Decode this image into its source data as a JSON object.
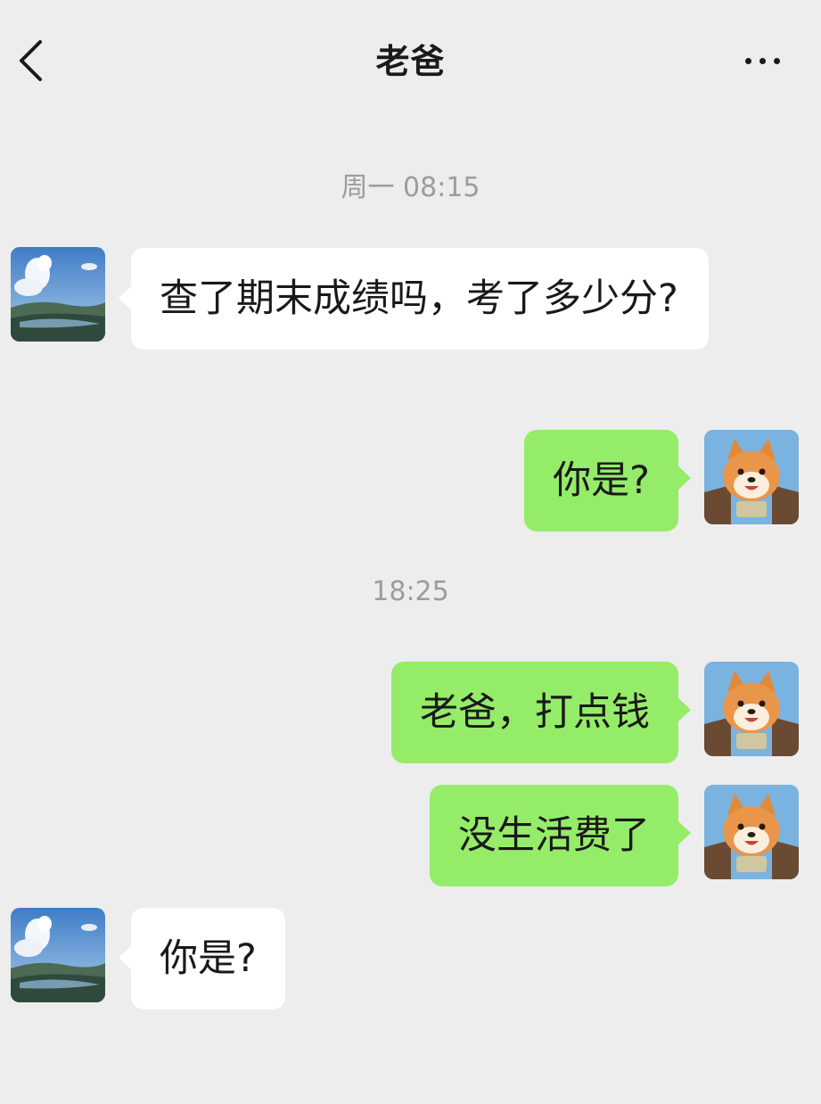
{
  "header": {
    "title": "老爸",
    "back_icon": "chevron-left-icon",
    "more_icon": "more-dots-icon"
  },
  "messages": [
    {
      "type": "timestamp",
      "text": "周一 08:15"
    },
    {
      "type": "incoming",
      "text": "查了期末成绩吗，考了多少分?",
      "avatar": "landscape-avatar"
    },
    {
      "type": "outgoing",
      "text": "你是?",
      "avatar": "shiba-avatar"
    },
    {
      "type": "timestamp",
      "text": "18:25"
    },
    {
      "type": "outgoing",
      "text": "老爸，打点钱",
      "avatar": "shiba-avatar"
    },
    {
      "type": "outgoing",
      "text": "没生活费了",
      "avatar": "shiba-avatar"
    },
    {
      "type": "incoming",
      "text": "你是?",
      "avatar": "landscape-avatar"
    }
  ],
  "colors": {
    "background": "#ededed",
    "outgoing_bubble": "#95ec69",
    "incoming_bubble": "#ffffff",
    "timestamp_text": "#9c9c9c"
  }
}
